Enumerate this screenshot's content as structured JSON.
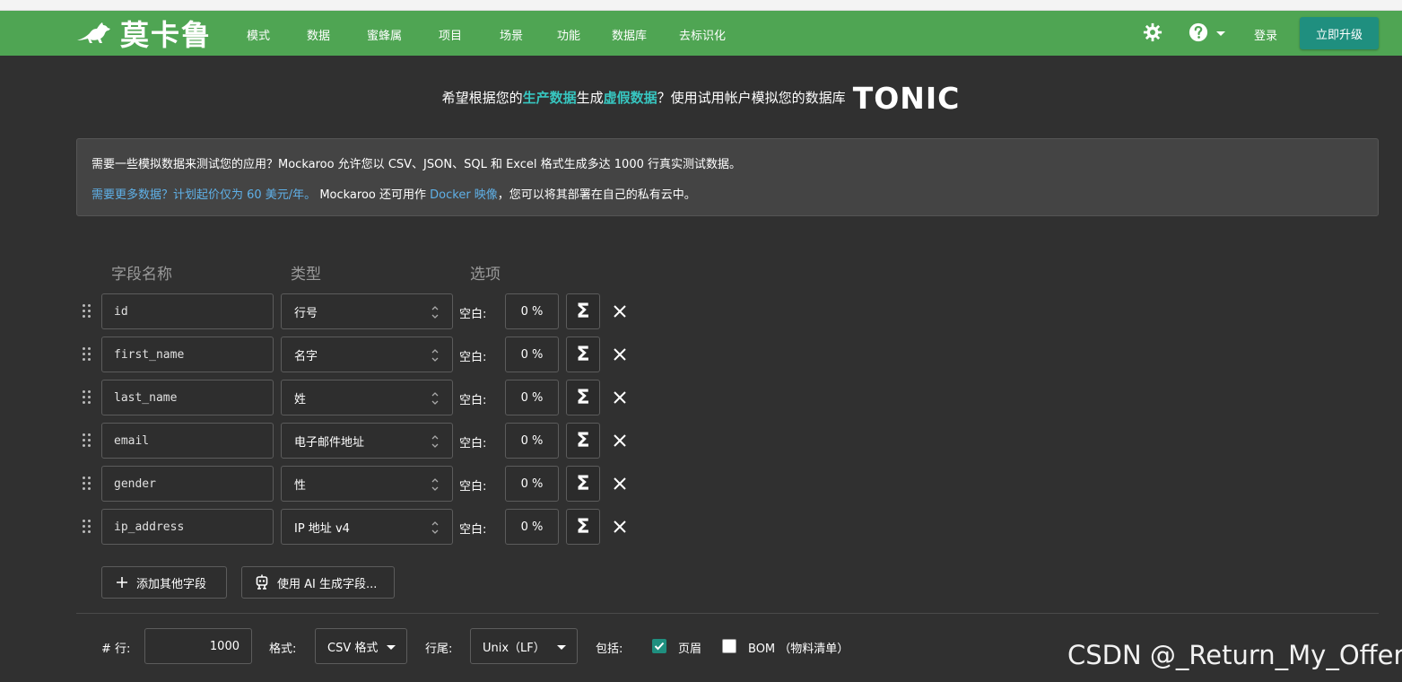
{
  "navbar": {
    "brand": "莫卡鲁",
    "items": [
      "模式",
      "数据",
      "蜜蜂属",
      "项目",
      "场景",
      "功能",
      "数据库",
      "去标识化"
    ],
    "login": "登录",
    "upgrade": "立即升级",
    "icons": [
      "kangaroo-logo",
      "gear-icon",
      "help-icon",
      "chevron-down-icon"
    ]
  },
  "promo": {
    "part1": "希望根据您的",
    "hl1": "生产数据",
    "part2": "生成",
    "hl2": "虚假数据",
    "part3": "？使用试用帐户模拟您的数据库",
    "brand": "TONIC"
  },
  "info": {
    "line1": "需要一些模拟数据来测试您的应用？Mockaroo 允许您以 CSV、JSON、SQL 和 Excel 格式生成多达 1000 行真实测试数据。",
    "line2_link1": "需要更多数据？计划起价仅为 60 美元/年。",
    "line2_text1": " Mockaroo 还可用作 ",
    "line2_link2": "Docker 映像",
    "line2_text2": "，您可以将其部署在自己的私有云中。"
  },
  "columns": {
    "name": "字段名称",
    "type": "类型",
    "options": "选项"
  },
  "fields": [
    {
      "name": "id",
      "type": "行号",
      "blank_label": "空白:",
      "blank": "0 %"
    },
    {
      "name": "first_name",
      "type": "名字",
      "blank_label": "空白:",
      "blank": "0 %"
    },
    {
      "name": "last_name",
      "type": "姓",
      "blank_label": "空白:",
      "blank": "0 %"
    },
    {
      "name": "email",
      "type": "电子邮件地址",
      "blank_label": "空白:",
      "blank": "0 %"
    },
    {
      "name": "gender",
      "type": "性",
      "blank_label": "空白:",
      "blank": "0 %"
    },
    {
      "name": "ip_address",
      "type": "IP 地址 v4",
      "blank_label": "空白:",
      "blank": "0 %"
    }
  ],
  "actions": {
    "add_field": "添加其他字段",
    "ai_generate": "使用 AI 生成字段..."
  },
  "bottom": {
    "rows_label": "# 行:",
    "rows_value": "1000",
    "format_label": "格式:",
    "format_value": "CSV 格式",
    "line_ending_label": "行尾:",
    "line_ending_value": "Unix（LF）",
    "include_label": "包括:",
    "header_label": "页眉",
    "header_checked": true,
    "bom_label": "BOM （物料清单）",
    "bom_checked": false
  },
  "watermark": "CSDN @_Return_My_Offer_",
  "colors": {
    "navbar": "#4fa553",
    "upgrade": "#1f8f7f",
    "highlight": "#37c6c0",
    "link": "#5fb1e8",
    "checkbox": "#1f8f7f"
  }
}
